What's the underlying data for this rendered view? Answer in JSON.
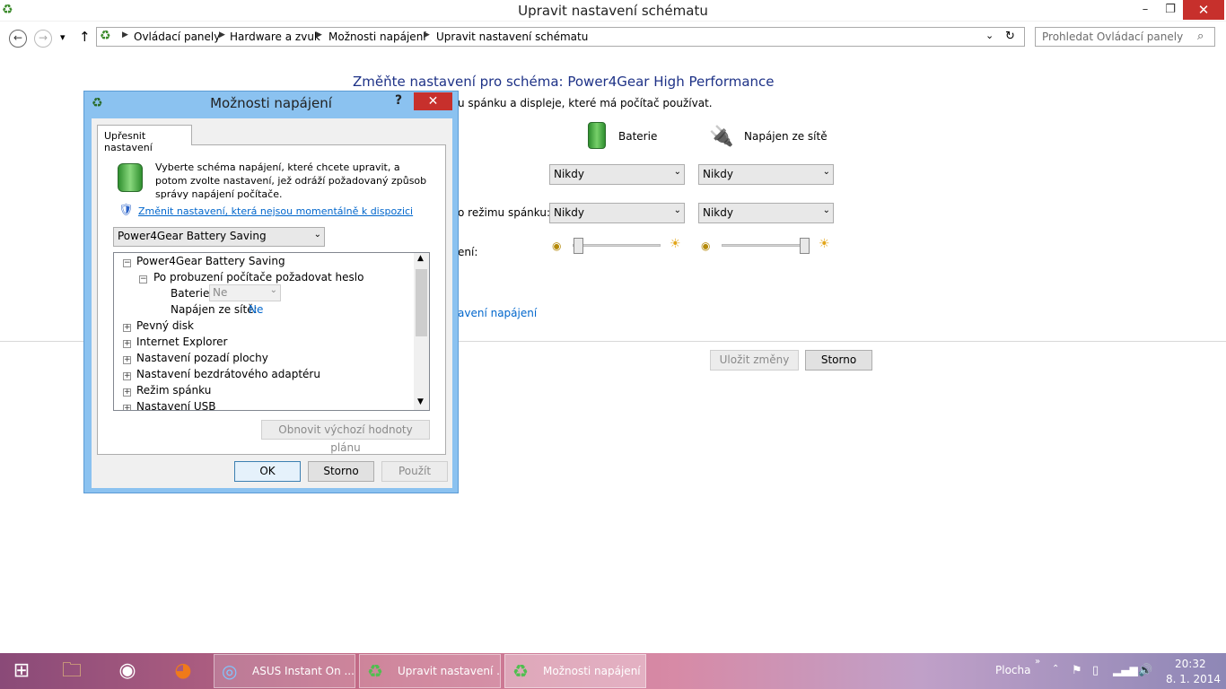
{
  "window": {
    "title": "Upravit nastavení schématu",
    "minimize": "–",
    "maximize": "❐",
    "close": "✕"
  },
  "nav": {
    "back": "←",
    "forward": "→",
    "dropdown": "▾",
    "up": "↑",
    "breadcrumbs": [
      "Ovládací panely",
      "Hardware a zvuk",
      "Možnosti napájení",
      "Upravit nastavení schématu"
    ],
    "refresh": "↻",
    "search_placeholder": "Prohledat Ovládací panely"
  },
  "main": {
    "heading": "Změňte nastavení pro schéma: Power4Gear High Performance",
    "subtitle": "u spánku a displeje, které má počítač používat.",
    "col_battery": "Baterie",
    "col_plugged": "Napájen ze sítě",
    "row1": {
      "battery": "Nikdy",
      "plugged": "Nikdy"
    },
    "row2_label": "o režimu spánku:",
    "row2": {
      "battery": "Nikdy",
      "plugged": "Nikdy"
    },
    "row3_label": "ení:",
    "brightness": {
      "battery": 0.0,
      "plugged": 1.0
    },
    "advanced_link": "avení napájení",
    "save_label": "Uložit změny",
    "cancel_label": "Storno"
  },
  "dialog": {
    "title": "Možnosti napájení",
    "help": "?",
    "close": "✕",
    "tab": "Upřesnit nastavení",
    "intro": "Vyberte schéma napájení, které chcete upravit, a potom zvolte nastavení, jež odráží požadovaný způsob správy napájení počítače.",
    "change_link": "Změnit nastavení, která nejsou momentálně k dispozici",
    "scheme_select": "Power4Gear Battery Saving",
    "tree": {
      "root": "Power4Gear Battery Saving",
      "child": "Po probuzení počítače požadovat heslo",
      "battery_label": "Baterie:",
      "battery_value": "Ne",
      "plugged_label": "Napájen ze sítě:",
      "plugged_value": "Ne",
      "items": [
        "Pevný disk",
        "Internet Explorer",
        "Nastavení pozadí plochy",
        "Nastavení bezdrátového adaptéru",
        "Režim spánku",
        "Nastavení USB"
      ]
    },
    "restore_label": "Obnovit výchozí hodnoty plánu",
    "ok_label": "OK",
    "cancel_label": "Storno",
    "apply_label": "Použít"
  },
  "taskbar": {
    "items": [
      {
        "label": "ASUS Instant On ..."
      },
      {
        "label": "Upravit nastavení ..."
      },
      {
        "label": "Možnosti napájení"
      }
    ],
    "desktop_label": "Plocha",
    "time": "20:32",
    "date": "8. 1. 2014"
  }
}
